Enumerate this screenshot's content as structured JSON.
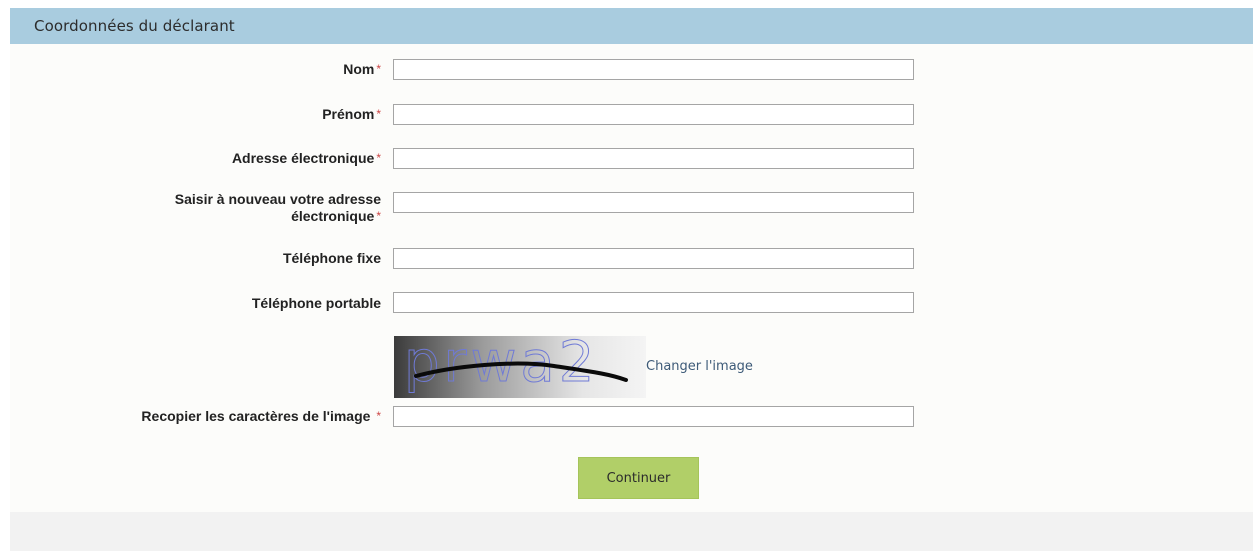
{
  "section": {
    "title": "Coordonnées du déclarant"
  },
  "fields": [
    {
      "label": "Nom",
      "required": "*",
      "value": ""
    },
    {
      "label": "Prénom",
      "required": "*",
      "value": ""
    },
    {
      "label": "Adresse électronique",
      "required": "*",
      "value": ""
    },
    {
      "label_line1": "Saisir à nouveau votre adresse",
      "label_line2": "électronique",
      "required": "*",
      "value": ""
    },
    {
      "label": "Téléphone fixe",
      "value": ""
    },
    {
      "label": "Téléphone portable",
      "value": ""
    }
  ],
  "captcha": {
    "image_text": "prwa2",
    "change_label": "Changer l'image",
    "input_label": "Recopier les caractères de l'image",
    "required": "*",
    "value": ""
  },
  "actions": {
    "continue_label": "Continuer"
  },
  "colors": {
    "header_bg": "#a9ccdf",
    "button_bg": "#b1cf68",
    "required": "#cc4444"
  }
}
